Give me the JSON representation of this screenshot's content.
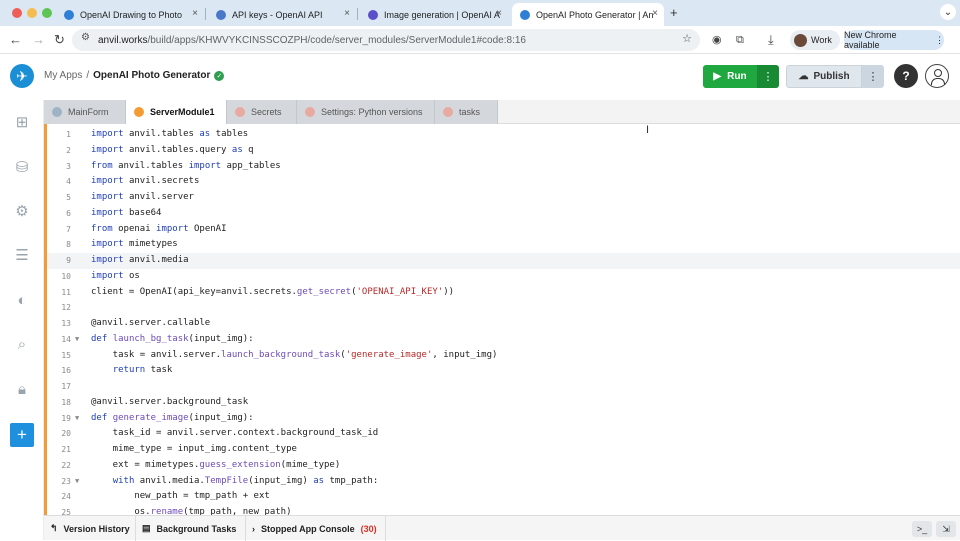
{
  "browser": {
    "tabs": [
      {
        "title": "OpenAI Drawing to Photo"
      },
      {
        "title": "API keys - OpenAI API"
      },
      {
        "title": "Image generation | OpenAI A"
      },
      {
        "title": "OpenAI Photo Generator | An"
      }
    ],
    "new_tab_symbol": "+",
    "dropdown_symbol": "⌄",
    "address": {
      "host": "anvil.works",
      "path": "/build/apps/KHWVYKCINSSCOZPH/code/server_modules/ServerModule1#code:8:16"
    },
    "profile_label": "Work",
    "update_label": "New Chrome available"
  },
  "app": {
    "breadcrumb_root": "My Apps",
    "breadcrumb_sep": "/",
    "app_name": "OpenAI Photo Generator",
    "run_label": "Run",
    "publish_label": "Publish",
    "help_symbol": "?",
    "more_symbol": "⋮"
  },
  "editor_tabs": [
    {
      "label": "MainForm"
    },
    {
      "label": "ServerModule1"
    },
    {
      "label": "Secrets"
    },
    {
      "label": "Settings: Python versions"
    },
    {
      "label": "tasks"
    }
  ],
  "code_lines": [
    {
      "n": "1"
    },
    {
      "n": "2"
    },
    {
      "n": "3"
    },
    {
      "n": "4"
    },
    {
      "n": "5"
    },
    {
      "n": "6"
    },
    {
      "n": "7"
    },
    {
      "n": "8"
    },
    {
      "n": "9"
    },
    {
      "n": "10"
    },
    {
      "n": "11"
    },
    {
      "n": "12"
    },
    {
      "n": "13"
    },
    {
      "n": "14"
    },
    {
      "n": "15"
    },
    {
      "n": "16"
    },
    {
      "n": "17"
    },
    {
      "n": "18"
    },
    {
      "n": "19"
    },
    {
      "n": "20"
    },
    {
      "n": "21"
    },
    {
      "n": "22"
    },
    {
      "n": "23"
    },
    {
      "n": "24"
    },
    {
      "n": "25"
    }
  ],
  "code_tokens": {
    "kw_import": "import",
    "kw_from": "from",
    "kw_as": "as",
    "kw_def": "def",
    "kw_return": "return",
    "kw_with": "with",
    "l1_mod": "anvil.tables",
    "l1_alias": "tables",
    "l2_mod": "anvil.tables.query",
    "l2_alias": "q",
    "l3_mod": "anvil.tables",
    "l3_name": "app_tables",
    "l4_mod": "anvil.secrets",
    "l5_mod": "anvil.server",
    "l6_mod": "base64",
    "l7_mod": "openai",
    "l7_name": "OpenAI",
    "l8_mod": "mimetypes",
    "l9_mod": "anvil.media",
    "l10_mod": "os",
    "l11_pre": "client = OpenAI(api_key=anvil.secrets.",
    "l11_fn": "get_secret",
    "l11_open": "(",
    "l11_str": "'OPENAI_API_KEY'",
    "l11_post": "))",
    "l13": "@anvil.server.callable",
    "l14_fn": "launch_bg_task",
    "l14_post": "(input_img):",
    "l15_pre": "    task = anvil.server.",
    "l15_fn": "launch_background_task",
    "l15_open": "(",
    "l15_str": "'generate_image'",
    "l15_post": ", input_img)",
    "l16_post": "task",
    "l18": "@anvil.server.background_task",
    "l19_fn": "generate_image",
    "l19_post": "(input_img):",
    "l20": "    task_id = anvil.server.context.background_task_id",
    "l21": "    mime_type = input_img.content_type",
    "l22_pre": "    ext = mimetypes.",
    "l22_fn": "guess_extension",
    "l22_post": "(mime_type)",
    "l23_pre": "anvil.media.",
    "l23_fn": "TempFile",
    "l23_mid": "(input_img)",
    "l23_post": "tmp_path:",
    "l24": "        new_path = tmp_path + ext",
    "l25_pre": "        os.",
    "l25_fn": "rename",
    "l25_post": "(tmp_path, new_path)"
  },
  "bottom_tabs": [
    {
      "label": "Version History"
    },
    {
      "label": "Background Tasks"
    },
    {
      "label": "Stopped App Console",
      "count": "(30)"
    }
  ],
  "icons": {
    "sidebar": [
      "app-tree-icon",
      "database-icon",
      "settings-icon",
      "list-icon",
      "palette-icon",
      "search-icon",
      "lock-icon",
      "add-icon"
    ]
  },
  "colors": {
    "accent": "#1e90de",
    "run": "#1fa83f",
    "modified_border": "#f39c34",
    "error": "#d93025"
  }
}
